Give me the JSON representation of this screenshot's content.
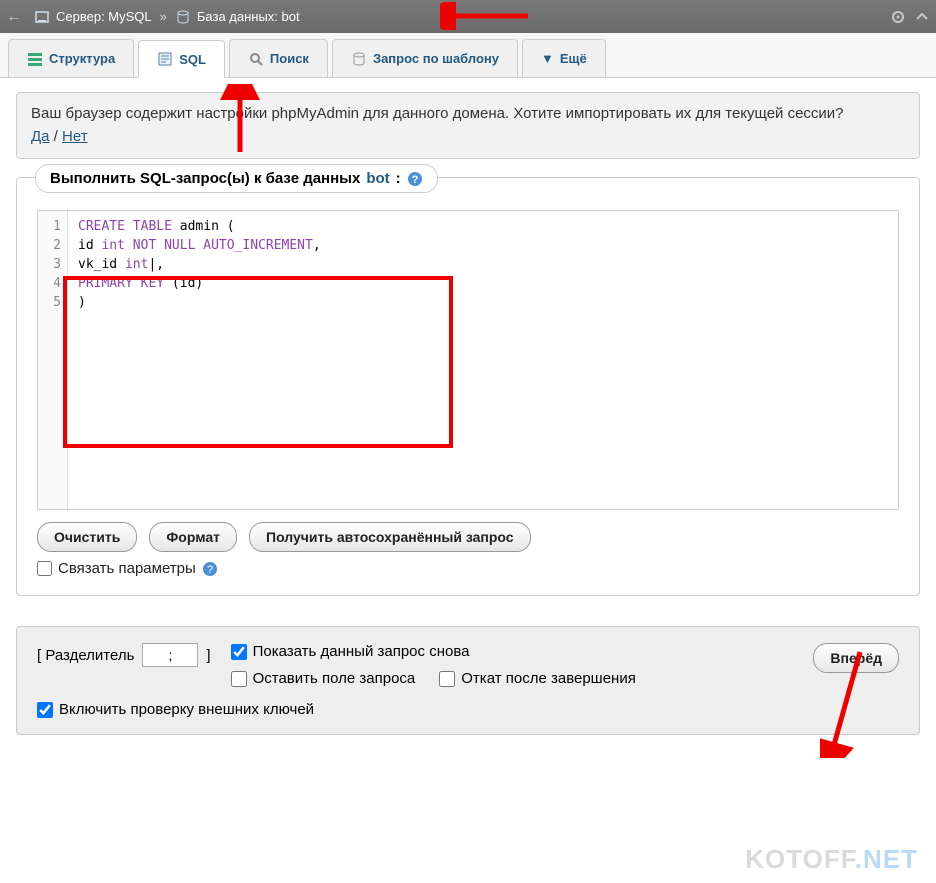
{
  "breadcrumb": {
    "server_label": "Сервер: MySQL",
    "db_label": "База данных: bot",
    "sep": "»"
  },
  "tabs": {
    "structure": "Структура",
    "sql": "SQL",
    "search": "Поиск",
    "query_by_template": "Запрос по шаблону",
    "more": "Ещё"
  },
  "notice": {
    "text": "Ваш браузер содержит настройки phpMyAdmin для данного домена. Хотите импортировать их для текущей сессии?",
    "yes": "Да",
    "no": "Нет",
    "sep": " / "
  },
  "panel": {
    "legend_prefix": "Выполнить SQL-запрос(ы) к базе данных ",
    "legend_db": "bot",
    "legend_suffix": ":"
  },
  "editor": {
    "lines": [
      "1",
      "2",
      "3",
      "4",
      "5"
    ],
    "code_html": "<span class='kw'>CREATE</span> <span class='kw'>TABLE</span> admin (\nid <span class='kw'>int</span> <span class='kw'>NOT</span> <span class='kw'>NULL</span> <span class='kw'>AUTO_INCREMENT</span>,\nvk_id <span class='kw'>int</span>|,\n<span class='kw'>PRIMARY</span> <span class='kw'>KEY</span> (id)\n)",
    "code_plain": "CREATE TABLE admin (\nid int NOT NULL AUTO_INCREMENT,\nvk_id int,\nPRIMARY KEY (id)\n)"
  },
  "buttons": {
    "clear": "Очистить",
    "format": "Формат",
    "get_autosaved": "Получить автосохранённый запрос",
    "go": "Вперёд"
  },
  "bind_params": "Связать параметры",
  "footer": {
    "delimiter_label_open": "[ Разделитель",
    "delimiter_value": ";",
    "delimiter_label_close": "]",
    "show_again": "Показать данный запрос снова",
    "retain_box": "Оставить поле запроса",
    "rollback": "Откат после завершения",
    "fk_check": "Включить проверку внешних ключей"
  },
  "watermark": {
    "a": "KOTOFF",
    "b": ".NET"
  }
}
